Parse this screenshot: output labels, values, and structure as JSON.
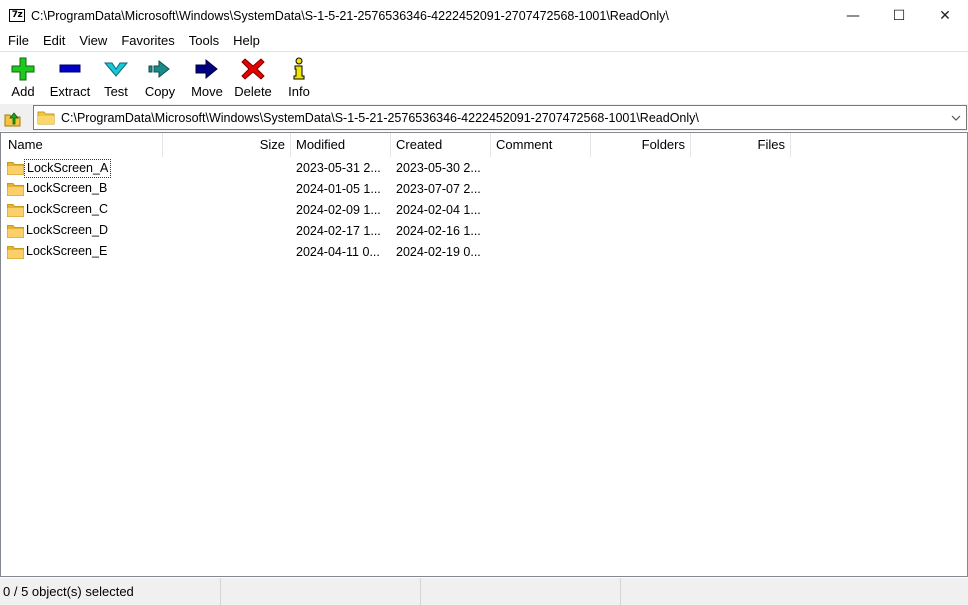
{
  "window": {
    "icon_text": "7z",
    "title": "C:\\ProgramData\\Microsoft\\Windows\\SystemData\\S-1-5-21-2576536346-4222452091-2707472568-1001\\ReadOnly\\",
    "controls": {
      "minimize": "—",
      "maximize": "☐",
      "close": "✕"
    }
  },
  "menu": [
    "File",
    "Edit",
    "View",
    "Favorites",
    "Tools",
    "Help"
  ],
  "toolbar": {
    "add": "Add",
    "extract": "Extract",
    "test": "Test",
    "copy": "Copy",
    "move": "Move",
    "delete": "Delete",
    "info": "Info"
  },
  "address": {
    "path": "C:\\ProgramData\\Microsoft\\Windows\\SystemData\\S-1-5-21-2576536346-4222452091-2707472568-1001\\ReadOnly\\"
  },
  "columns": {
    "name": "Name",
    "size": "Size",
    "modified": "Modified",
    "created": "Created",
    "comment": "Comment",
    "folders": "Folders",
    "files": "Files"
  },
  "rows": [
    {
      "name": "LockScreen_A",
      "modified": "2023-05-31 2...",
      "created": "2023-05-30 2..."
    },
    {
      "name": "LockScreen_B",
      "modified": "2024-01-05 1...",
      "created": "2023-07-07 2..."
    },
    {
      "name": "LockScreen_C",
      "modified": "2024-02-09 1...",
      "created": "2024-02-04 1..."
    },
    {
      "name": "LockScreen_D",
      "modified": "2024-02-17 1...",
      "created": "2024-02-16 1..."
    },
    {
      "name": "LockScreen_E",
      "modified": "2024-04-11 0...",
      "created": "2024-02-19 0..."
    }
  ],
  "status": {
    "selection": "0 / 5 object(s) selected"
  },
  "icons": {
    "add": "green-plus-icon",
    "extract": "blue-minus-icon",
    "test": "cyan-check-chevron-icon",
    "copy": "teal-double-arrow-icon",
    "move": "navy-arrow-icon",
    "delete": "red-x-icon",
    "info": "yellow-info-icon",
    "folder": "folder-icon"
  },
  "colors": {
    "add": "#1fc81f",
    "extract": "#0000c8",
    "test": "#16c8d8",
    "copy": "#1a8a8a",
    "move": "#000080",
    "delete": "#e60000",
    "info": "#f2e600",
    "folder": "#f5c542"
  }
}
